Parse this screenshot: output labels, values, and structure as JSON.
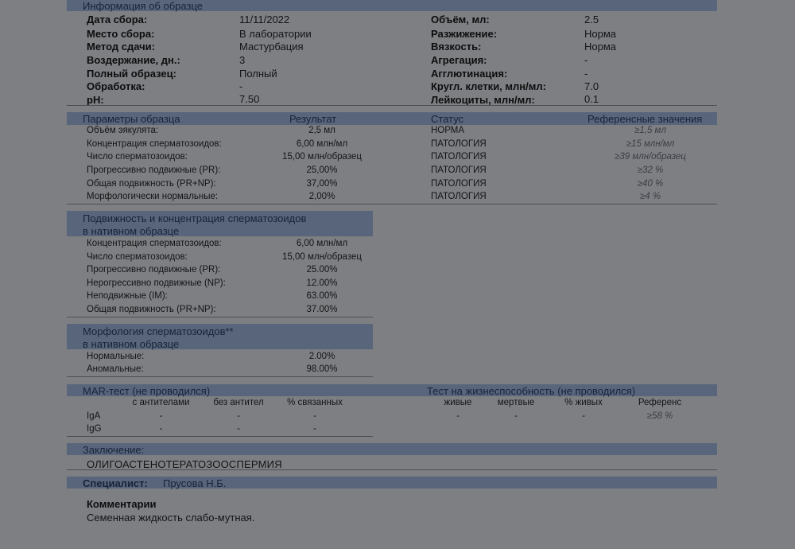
{
  "sample_info": {
    "title": "Информация об образце",
    "left": [
      {
        "label": "Дата сбора:",
        "value": "11/11/2022"
      },
      {
        "label": "Место сбора:",
        "value": "В лаборатории"
      },
      {
        "label": "Метод сдачи:",
        "value": "Мастурбация"
      },
      {
        "label": "Воздержание, дн.:",
        "value": "3"
      },
      {
        "label": "Полный образец:",
        "value": "Полный"
      },
      {
        "label": "Обработка:",
        "value": "-"
      },
      {
        "label": "pH:",
        "value": "7.50"
      }
    ],
    "right": [
      {
        "label": "Объём, мл:",
        "value": "2.5"
      },
      {
        "label": "Разжижение:",
        "value": "Норма"
      },
      {
        "label": "Вязкость:",
        "value": "Норма"
      },
      {
        "label": "Агрегация:",
        "value": "-"
      },
      {
        "label": "Агглютинация:",
        "value": "-"
      },
      {
        "label": "Кругл. клетки, млн/мл:",
        "value": "7.0"
      },
      {
        "label": "Лейкоциты, млн/мл:",
        "value": "0.1"
      }
    ]
  },
  "params": {
    "headers": {
      "param": "Параметры образца",
      "result": "Результат",
      "status": "Статус",
      "ref": "Референсные значения"
    },
    "rows": [
      {
        "name": "Объём эякулята:",
        "result": "2,5 мл",
        "status": "НОРМА",
        "ref": "≥1,5 мл"
      },
      {
        "name": "Концентрация сперматозоидов:",
        "result": "6,00 млн/мл",
        "status": "ПАТОЛОГИЯ",
        "ref": "≥15 млн/мл"
      },
      {
        "name": "Число сперматозоидов:",
        "result": "15,00 млн/образец",
        "status": "ПАТОЛОГИЯ",
        "ref": "≥39 млн/образец"
      },
      {
        "name": "Прогрессивно подвижные (PR):",
        "result": "25,00%",
        "status": "ПАТОЛОГИЯ",
        "ref": "≥32 %"
      },
      {
        "name": "Общая подвижность (PR+NP):",
        "result": "37,00%",
        "status": "ПАТОЛОГИЯ",
        "ref": "≥40 %"
      },
      {
        "name": "Морфологически нормальные:",
        "result": "2,00%",
        "status": "ПАТОЛОГИЯ",
        "ref": "≥4 %"
      }
    ]
  },
  "motility": {
    "title_line1": "Подвижность и концентрация сперматозоидов",
    "title_line2": "в нативном образце",
    "rows": [
      {
        "name": "Концентрация сперматозоидов:",
        "value": "6,00 млн/мл"
      },
      {
        "name": "Число сперматозоидов:",
        "value": "15,00 млн/образец"
      },
      {
        "name": "Прогрессивно подвижные (PR):",
        "value": "25.00%"
      },
      {
        "name": "Нерогрессивно подвижные (NP):",
        "value": "12.00%"
      },
      {
        "name": "Неподвижные (IM):",
        "value": "63.00%"
      },
      {
        "name": "Общая подвижность (PR+NP):",
        "value": "37.00%"
      }
    ]
  },
  "morphology": {
    "title_line1": "Морфология сперматозоидов**",
    "title_line2": "в нативном образце",
    "rows": [
      {
        "name": "Нормальные:",
        "value": "2.00%"
      },
      {
        "name": "Аномальные:",
        "value": "98.00%"
      }
    ]
  },
  "mar": {
    "title": "MAR-тест (не проводился)",
    "cols": [
      "с антителами",
      "без антител",
      "% связанных"
    ],
    "rows": [
      {
        "name": "IgA",
        "values": [
          "-",
          "-",
          "-"
        ]
      },
      {
        "name": "IgG",
        "values": [
          "-",
          "-",
          "-"
        ]
      }
    ]
  },
  "viability": {
    "title": "Тест на жизнеспособность (не проводился)",
    "cols": [
      "живые",
      "мертвые",
      "% живых",
      "Референс"
    ],
    "values": [
      "-",
      "-",
      "-",
      "≥58 %"
    ]
  },
  "conclusion": {
    "title": "Заключение:",
    "text": "ОЛИГОАСТЕНОТЕРАТОЗООСПЕРМИЯ"
  },
  "specialist": {
    "label": "Специалист:",
    "name": "Прусова Н.Б."
  },
  "comments": {
    "label": "Комментарии",
    "text": "Семенная жидкость слабо-мутная."
  }
}
